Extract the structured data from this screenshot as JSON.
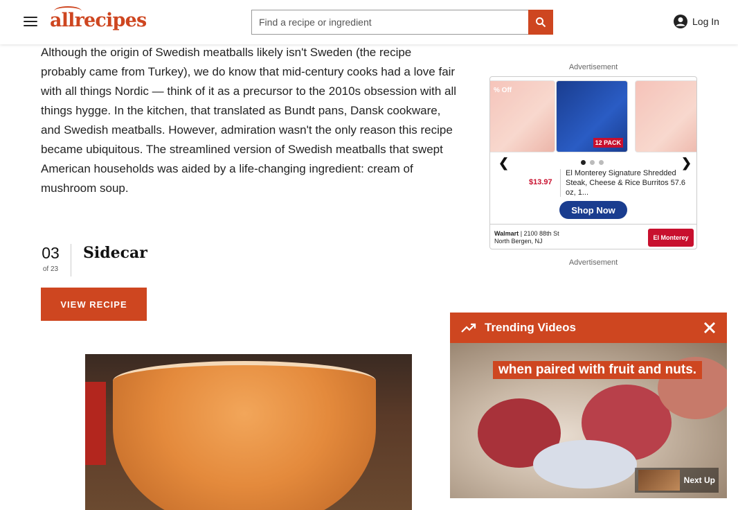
{
  "header": {
    "logo_text": "allrecipes",
    "search_placeholder": "Find a recipe or ingredient",
    "login_label": "Log In"
  },
  "article": {
    "intro": "Although the origin of Swedish meatballs likely isn't Sweden (the recipe probably came from Turkey), we do know that mid-century cooks had a love fair with all things Nordic — think of it as a precursor to the 2010s obsession with all things hygge. In the kitchen, that translated as Bundt pans, Dansk cookware, and Swedish meatballs. However, admiration wasn't the only reason this recipe became ubiquitous. The streamlined version of Swedish meatballs that swept American households was aided by a life-changing ingredient: cream of mushroom soup.",
    "item_number": "03",
    "item_of": "of 23",
    "item_title": "Sidecar",
    "view_recipe_label": "VIEW RECIPE"
  },
  "ad": {
    "label_top": "Advertisement",
    "label_bottom": "Advertisement",
    "price": "$13.97",
    "description": "El Monterey Signature Shredded Steak, Cheese & Rice Burritos 57.6 oz, 1...",
    "shop_label": "Shop Now",
    "store_name": "Walmart",
    "store_address_line1": "2100 88th St",
    "store_address_line2": "North Bergen, NJ",
    "brand": "El Monterey",
    "pack_tag": "12 PACK",
    "side_label": "% Off"
  },
  "video": {
    "title": "Trending Videos",
    "caption": "when paired with fruit and nuts.",
    "next_up_label": "Next Up"
  },
  "colors": {
    "brand": "#ce4620"
  }
}
